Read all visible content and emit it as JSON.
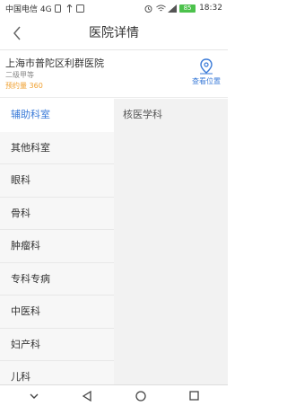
{
  "status_bar": {
    "carrier": "中国电信 4G",
    "time": "18:32",
    "battery": "85"
  },
  "header": {
    "title": "医院详情"
  },
  "hospital": {
    "name": "上海市普陀区利群医院",
    "level": "二级甲等",
    "booking": "预约量 360",
    "location_label": "查看位置"
  },
  "departments": [
    {
      "label": "辅助科室"
    },
    {
      "label": "其他科室"
    },
    {
      "label": "眼科"
    },
    {
      "label": "骨科"
    },
    {
      "label": "肿瘤科"
    },
    {
      "label": "专科专病"
    },
    {
      "label": "中医科"
    },
    {
      "label": "妇产科"
    },
    {
      "label": "儿科"
    }
  ],
  "sub_departments": [
    {
      "label": "核医学科"
    }
  ],
  "colors": {
    "accent": "#3b7bd8",
    "booking": "#f0a030",
    "list_bg": "#f7f7f7",
    "panel_bg": "#f2f2f2"
  }
}
